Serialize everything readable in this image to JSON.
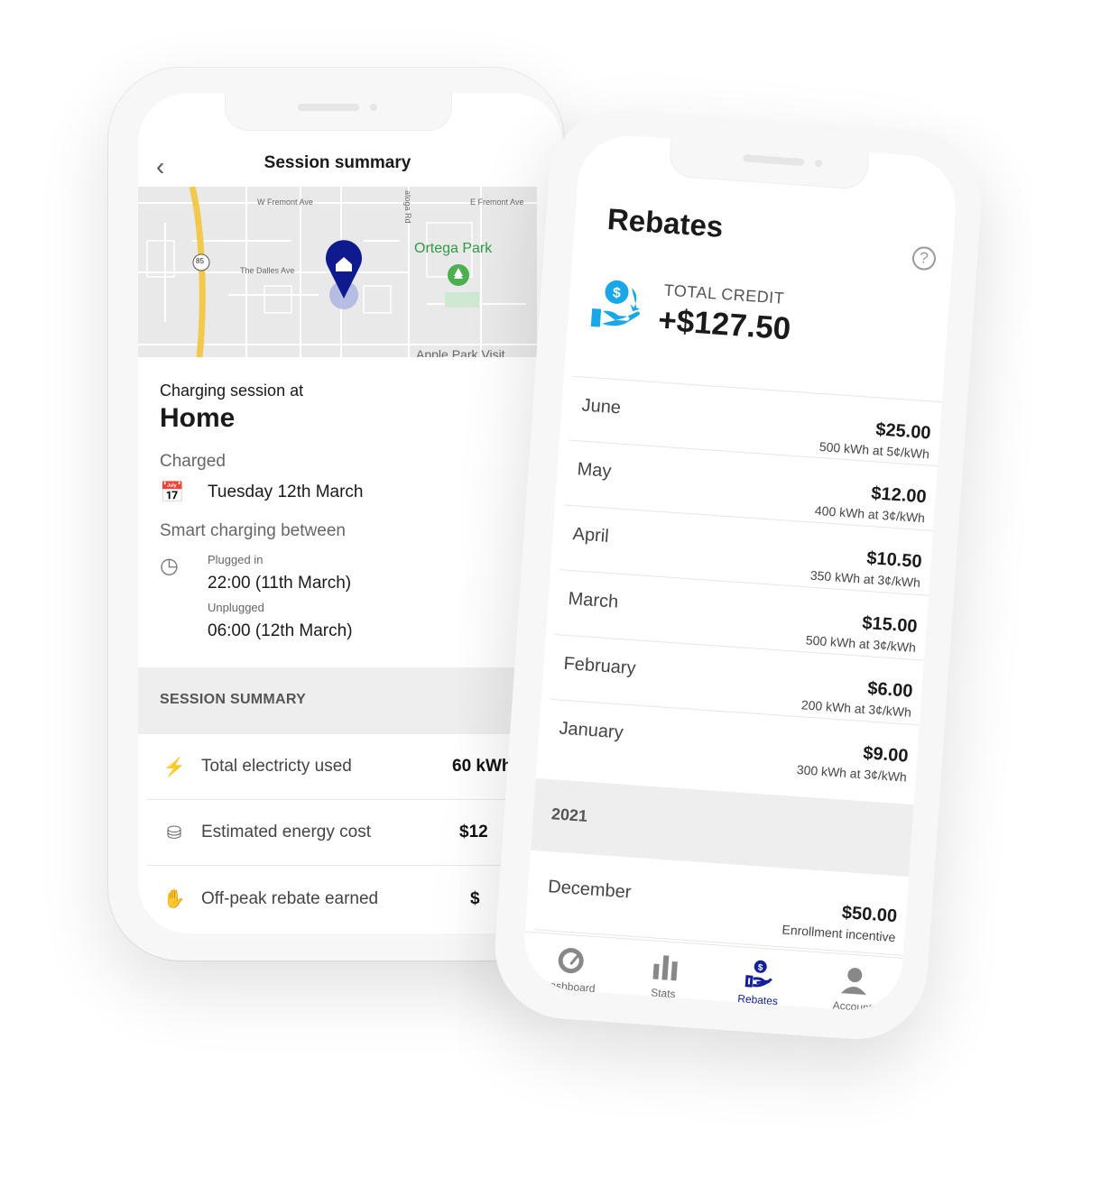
{
  "session": {
    "title": "Session summary",
    "map": {
      "streets": [
        "W Fremont Ave",
        "E Fremont Ave",
        "The Dalles Ave",
        "atoga Rd",
        "Apple Park Visit"
      ],
      "highway": "85",
      "park": "Ortega Park"
    },
    "at_label": "Charging session at",
    "location": "Home",
    "charged_label": "Charged",
    "date": "Tuesday 12th March",
    "smart_label": "Smart charging between",
    "plugged_label": "Plugged in",
    "plugged_value": "22:00 (11th March)",
    "unplugged_label": "Unplugged",
    "unplugged_value": "06:00 (12th March)",
    "summary_header": "SESSION SUMMARY",
    "rows": [
      {
        "label": "Total electricty used",
        "value": "60 kWh",
        "icon": "bolt-icon"
      },
      {
        "label": "Estimated energy cost",
        "value": "$12",
        "icon": "coins-icon"
      },
      {
        "label": "Off-peak rebate earned",
        "value": "$",
        "icon": "rebate-icon"
      }
    ]
  },
  "rebates": {
    "title": "Rebates",
    "total_label": "TOTAL CREDIT",
    "total_value": "+$127.50",
    "months": [
      {
        "month": "June",
        "amount": "$25.00",
        "detail": "500 kWh at 5¢/kWh"
      },
      {
        "month": "May",
        "amount": "$12.00",
        "detail": "400 kWh at 3¢/kWh"
      },
      {
        "month": "April",
        "amount": "$10.50",
        "detail": "350 kWh at 3¢/kWh"
      },
      {
        "month": "March",
        "amount": "$15.00",
        "detail": "500 kWh at 3¢/kWh"
      },
      {
        "month": "February",
        "amount": "$6.00",
        "detail": "200 kWh at 3¢/kWh"
      },
      {
        "month": "January",
        "amount": "$9.00",
        "detail": "300 kWh at 3¢/kWh"
      }
    ],
    "year": "2021",
    "december": {
      "month": "December",
      "amount": "$50.00",
      "detail": "Enrollment incentive"
    },
    "nav": [
      {
        "label": "Dashboard"
      },
      {
        "label": "Stats"
      },
      {
        "label": "Rebates",
        "active": true
      },
      {
        "label": "Account"
      }
    ],
    "accent": "#14209b",
    "icon_color": "#1aa7e8"
  }
}
